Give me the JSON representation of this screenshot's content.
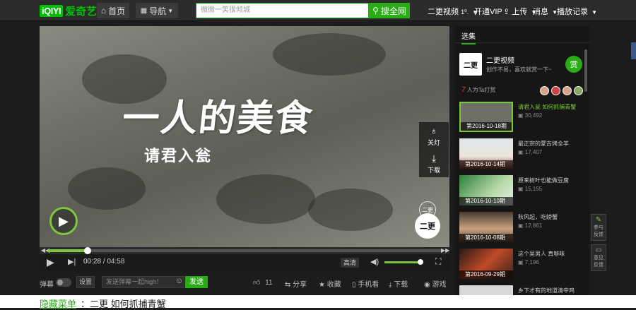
{
  "header": {
    "logo_mark": "iQIYI",
    "logo_text": "爱奇艺",
    "home": "首页",
    "guide": "导航",
    "search_placeholder": "微微一笑很倾城",
    "search_button": "搜全网",
    "user": "二更视频",
    "vip": "开通VIP",
    "upload": "上传",
    "messages": "消息",
    "history": "播放记录"
  },
  "player": {
    "title_art": "一人的美食",
    "subtitle_art": "请君入瓮",
    "lights_label": "关灯",
    "download_label": "下载",
    "time_current": "00:28",
    "time_total": "04:58",
    "progress_fraction": 0.1,
    "quality": "高清",
    "volume_fraction": 0.95,
    "watermark": "二更"
  },
  "actionbar": {
    "danmu_label": "弹幕",
    "settings": "设置",
    "danmu_placeholder": "发送弹幕一起high！",
    "send": "发送",
    "likes": "11",
    "share": "分享",
    "favorite": "收藏",
    "phone": "手机看",
    "download": "下载",
    "game": "游戏"
  },
  "sidebar": {
    "tab": "选集",
    "channel_name": "二更视频",
    "channel_desc": "创作不易，喜欢就赏一下~",
    "reward": "赏",
    "tip_count": "7",
    "tip_text": "人为Ta打赏",
    "episodes": [
      {
        "title": "请君入瓮 如何抓捕青蟹",
        "views": "30,492",
        "date": "第2016-10-18期",
        "active": true
      },
      {
        "title": "最正宗的蒙古烤全羊",
        "views": "17,407",
        "date": "第2016-10-14期",
        "active": false
      },
      {
        "title": "原来树叶也能做豆腐",
        "views": "15,155",
        "date": "第2016-10-10期",
        "active": false
      },
      {
        "title": "秋风起，吃螃蟹",
        "views": "12,861",
        "date": "第2016-10-08期",
        "active": false
      },
      {
        "title": "这个吴男人 真够味",
        "views": "7,196",
        "date": "第2016-09-29期",
        "active": false
      },
      {
        "title": "乡下才有的地道清中鸡",
        "views": "",
        "date": "",
        "active": false
      }
    ]
  },
  "floating": {
    "feedback_ideas": "意见反馈",
    "feedback_label": "反馈",
    "publish": "参与反馈"
  },
  "below": {
    "hidden_menu": "隐藏菜单",
    "video_title": "：二更 如何抓捕青蟹"
  }
}
